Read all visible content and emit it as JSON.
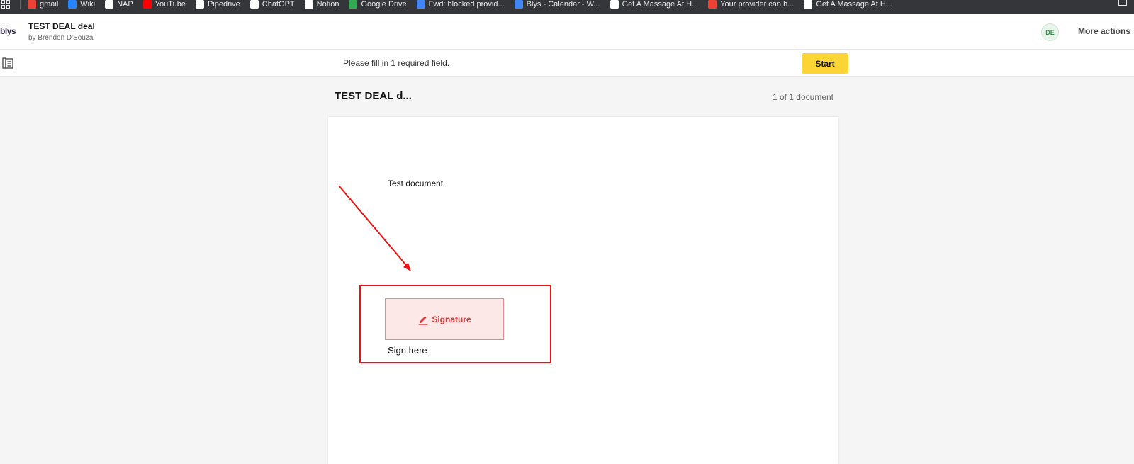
{
  "browser": {
    "bookmarks": [
      {
        "label": "gmail",
        "icon": "gmail-icon",
        "color": "#ea4335"
      },
      {
        "label": "Wiki",
        "icon": "confluence-icon",
        "color": "#2684ff"
      },
      {
        "label": "NAP",
        "icon": "page-icon",
        "color": "#ffffff"
      },
      {
        "label": "YouTube",
        "icon": "youtube-icon",
        "color": "#ff0000"
      },
      {
        "label": "Pipedrive",
        "icon": "pipedrive-icon",
        "color": "#ffffff"
      },
      {
        "label": "ChatGPT",
        "icon": "chatgpt-icon",
        "color": "#ffffff"
      },
      {
        "label": "Notion",
        "icon": "notion-icon",
        "color": "#ffffff"
      },
      {
        "label": "Google Drive",
        "icon": "google-drive-icon",
        "color": "#34a853"
      },
      {
        "label": "Fwd: blocked provid...",
        "icon": "google-icon",
        "color": "#4285f4"
      },
      {
        "label": "Blys - Calendar - W...",
        "icon": "calendar-icon",
        "color": "#4285f4"
      },
      {
        "label": "Get A Massage At H...",
        "icon": "page-icon",
        "color": "#ffffff"
      },
      {
        "label": "Your provider can h...",
        "icon": "gmail-icon",
        "color": "#ea4335"
      },
      {
        "label": "Get A Massage At H...",
        "icon": "page-icon",
        "color": "#ffffff"
      }
    ]
  },
  "header": {
    "logo": "blys",
    "title": "TEST DEAL deal",
    "author": "by Brendon D'Souza",
    "avatar_initials": "DE",
    "more_actions": "More actions"
  },
  "infobar": {
    "notice": "Please fill in 1 required field.",
    "start_label": "Start"
  },
  "viewer": {
    "title": "TEST DEAL d...",
    "doc_count": "1 of 1 document",
    "page": {
      "text": "Test document",
      "signature_label": "Signature",
      "sign_here": "Sign here"
    }
  },
  "colors": {
    "start_button": "#fcd535",
    "signature_fill": "#fde8e8",
    "signature_text": "#d63a3a",
    "annotation": "#ee1111"
  }
}
